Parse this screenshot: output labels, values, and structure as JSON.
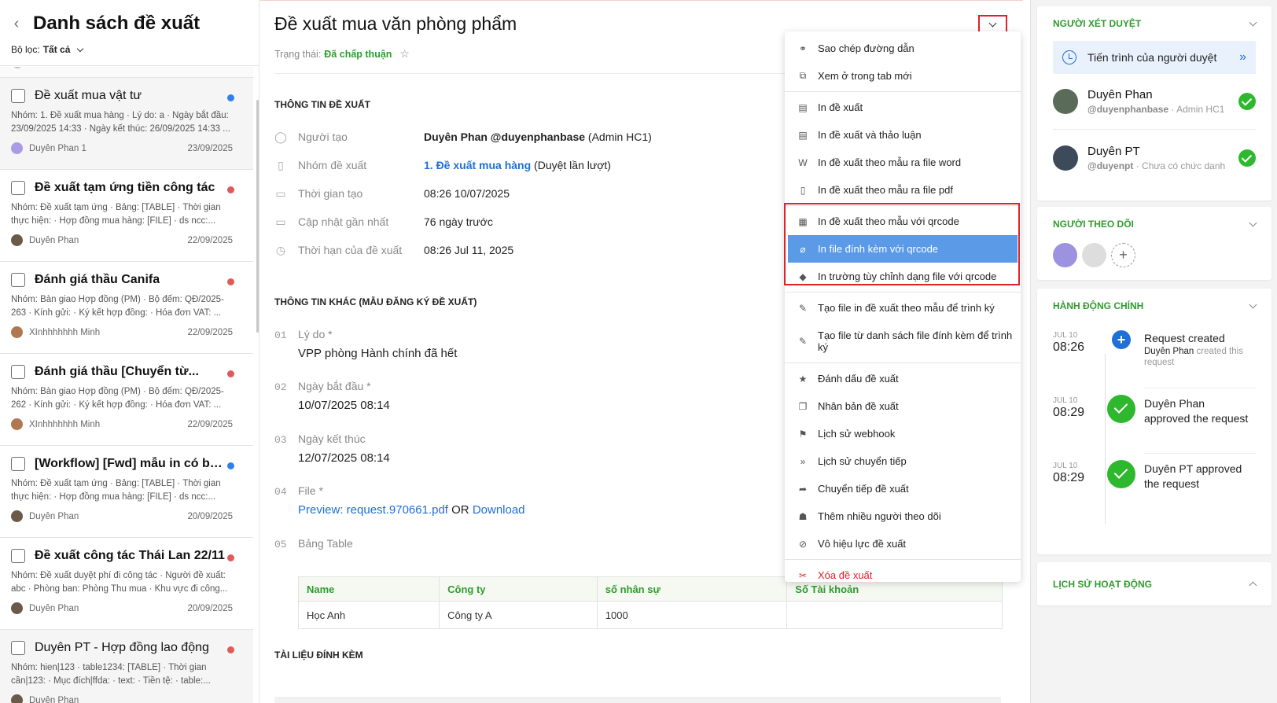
{
  "left": {
    "title": "Danh sách đề xuất",
    "filter_label": "Bộ lọc:",
    "filter_value": "Tất cả",
    "items": [
      {
        "title": "Đề xuất mua vật tư",
        "bold": false,
        "dot": "#2f80ed",
        "desc": "Nhóm: 1. Đề xuất mua hàng · Lý do: a · Ngày bắt đầu: 23/09/2025 14:33 · Ngày kết thúc: 26/09/2025 14:33 ...",
        "author": "Duyên Phan 1",
        "date": "23/09/2025",
        "gray": true
      },
      {
        "title": "Đề xuất tạm ứng tiền công tác",
        "bold": true,
        "dot": "#e05a5a",
        "desc": "Nhóm: Đề xuất tạm ứng · Bảng: [TABLE] · Thời gian thực hiện: · Hợp đồng mua hàng: [FILE] · ds ncc:...",
        "author": "Duyên Phan",
        "date": "22/09/2025",
        "gray": false
      },
      {
        "title": "Đánh giá thầu Canifa",
        "bold": true,
        "dot": "#e05a5a",
        "desc": "Nhóm: Bàn giao Hợp đồng (PM) · Bộ đếm: QĐ/2025-263 · Kính gửi: · Ký kết hợp đồng: · Hóa đơn VAT: ...",
        "author": "XInhhhhhhh Minh",
        "date": "22/09/2025",
        "gray": false
      },
      {
        "title": "Đánh giá thầu [Chuyển từ...",
        "bold": true,
        "dot": "#e05a5a",
        "desc": "Nhóm: Bàn giao Hợp đồng (PM) · Bộ đếm: QĐ/2025-262 · Kính gửi: · Ký kết hợp đồng: · Hóa đơn VAT: ...",
        "author": "XInhhhhhhh Minh",
        "date": "22/09/2025",
        "gray": false
      },
      {
        "title": "[Workflow] [Fwd] mẫu in có bản...",
        "bold": true,
        "dot": "#2f80ed",
        "desc": "Nhóm: Đề xuất tạm ứng · Bảng: [TABLE] · Thời gian thực hiện: · Hợp đồng mua hàng: [FILE] · ds ncc:...",
        "author": "Duyên Phan",
        "date": "20/09/2025",
        "gray": false
      },
      {
        "title": "Đề xuất công tác Thái Lan 22/11",
        "bold": true,
        "dot": "#e05a5a",
        "desc": "Nhóm: Đề xuất duyệt phí đi công tác · Người đề xuất: abc · Phòng ban: Phòng Thu mua · Khu vực đi công...",
        "author": "Duyên Phan",
        "date": "20/09/2025",
        "gray": false
      },
      {
        "title": "Duyên PT - Hợp đồng lao động",
        "bold": false,
        "dot": "#e05a5a",
        "desc": "Nhóm: hien|123 · table1234: [TABLE] · Thời gian cần|123: · Mục đích|ffda: · text: · Tiền tệ: · table:...",
        "author": "Duyên Phan",
        "date": "",
        "gray": true
      }
    ]
  },
  "main": {
    "title": "Đề xuất mua văn phòng phẩm",
    "status_label": "Trạng thái:",
    "status_value": "Đã chấp thuận",
    "section_info": "THÔNG TIN ĐỀ XUẤT",
    "fields": [
      {
        "icon": "user-icon",
        "label": "Người tạo",
        "value_bold": "Duyên Phan @duyenphanbase",
        "value": " (Admin HC1)"
      },
      {
        "icon": "clipboard-icon",
        "label": "Nhóm đề xuất",
        "value_link": "1. Đề xuất mua hàng",
        "value": " (Duyệt lần lượt)"
      },
      {
        "icon": "calendar-icon",
        "label": "Thời gian tạo",
        "value": "08:26 10/07/2025"
      },
      {
        "icon": "calendar-icon",
        "label": "Cập nhật gần nhất",
        "value": "76 ngày trước"
      },
      {
        "icon": "clock-icon",
        "label": "Thời hạn của đề xuất",
        "value": "08:26 Jul 11, 2025"
      }
    ],
    "section_other": "THÔNG TIN KHÁC (MẪU ĐĂNG KÝ ĐỀ XUẤT)",
    "other": [
      {
        "num": "01",
        "label": "Lý do *",
        "value": "VPP phòng Hành chính đã hết"
      },
      {
        "num": "02",
        "label": "Ngày bắt đầu *",
        "value": "10/07/2025 08:14"
      },
      {
        "num": "03",
        "label": "Ngày kết thúc",
        "value": "12/07/2025 08:14"
      },
      {
        "num": "04",
        "label": "File *",
        "preview": "Preview: request.970661.pdf",
        "or": " OR ",
        "download": "Download"
      },
      {
        "num": "05",
        "label": "Bảng Table"
      }
    ],
    "table": {
      "headers": [
        "Name",
        "Công ty",
        "số nhân sự",
        "Số Tài khoản"
      ],
      "rows": [
        [
          "Học Anh",
          "Công ty A",
          "1000",
          ""
        ]
      ]
    },
    "section_attach": "TÀI LIỆU ĐÍNH KÈM"
  },
  "menu": {
    "items": [
      {
        "icon": "link-icon",
        "glyph": "⚭",
        "label": "Sao chép đường dẫn"
      },
      {
        "icon": "external-link-icon",
        "glyph": "⧉",
        "label": "Xem ở trong tab mới"
      },
      {
        "sep": true
      },
      {
        "icon": "printer-icon",
        "glyph": "▤",
        "label": "In đề xuất"
      },
      {
        "icon": "printer-icon",
        "glyph": "▤",
        "label": "In đề xuất và thảo luận"
      },
      {
        "icon": "word-file-icon",
        "glyph": "W",
        "label": "In đề xuất theo mẫu ra file word"
      },
      {
        "icon": "pdf-file-icon",
        "glyph": "▯",
        "label": "In đề xuất theo mẫu ra file pdf"
      },
      {
        "sep": true
      },
      {
        "icon": "qrcode-icon",
        "glyph": "▦",
        "label": "In đề xuất theo mẫu với qrcode"
      },
      {
        "icon": "paperclip-icon",
        "glyph": "⌀",
        "label": "In file đính kèm với qrcode",
        "active": true
      },
      {
        "icon": "layers-icon",
        "glyph": "◆",
        "label": "In trường tùy chỉnh dạng file với qrcode"
      },
      {
        "sep": true
      },
      {
        "icon": "pencil-icon",
        "glyph": "✎",
        "label": "Tạo file in đề xuất theo mẫu để trình ký"
      },
      {
        "icon": "pencil-icon",
        "glyph": "✎",
        "label": "Tạo file từ danh sách file đính kèm để trình ký",
        "tall": true
      },
      {
        "sep": true
      },
      {
        "icon": "star-icon",
        "glyph": "★",
        "label": "Đánh dấu đề xuất"
      },
      {
        "icon": "copy-icon",
        "glyph": "❐",
        "label": "Nhân bản đề xuất"
      },
      {
        "icon": "flag-icon",
        "glyph": "⚑",
        "label": "Lịch sử webhook"
      },
      {
        "icon": "forward-icon",
        "glyph": "»",
        "label": "Lịch sử chuyển tiếp"
      },
      {
        "icon": "share-icon",
        "glyph": "➦",
        "label": "Chuyển tiếp đề xuất"
      },
      {
        "icon": "users-icon",
        "glyph": "☗",
        "label": "Thêm nhiều người theo dõi"
      },
      {
        "icon": "ban-icon",
        "glyph": "⊘",
        "label": "Vô hiệu lực đề xuất"
      },
      {
        "sep": true
      },
      {
        "icon": "scissors-icon",
        "glyph": "✂",
        "label": "Xóa đề xuất",
        "danger": true
      }
    ]
  },
  "right": {
    "approvers_title": "NGƯỜI XÉT DUYỆT",
    "progress_label": "Tiến trình của người duyệt",
    "approvers": [
      {
        "name": "Duyên Phan",
        "handle": "@duyenphanbase",
        "role": " · Admin HC1"
      },
      {
        "name": "Duyên PT",
        "handle": "@duyenpt",
        "role": " · Chưa có chức danh"
      }
    ],
    "followers_title": "NGƯỜI THEO DÕI",
    "actions_title": "HÀNH ĐỘNG CHÍNH",
    "timeline": [
      {
        "month": "JUL 10",
        "time": "08:26",
        "text": "Request created",
        "by": "Duyên Phan",
        "by_suffix": " created this request",
        "kind": "created"
      },
      {
        "month": "JUL 10",
        "time": "08:29",
        "text": "Duyên Phan",
        "text2": "approved the request",
        "kind": "approved"
      },
      {
        "month": "JUL 10",
        "time": "08:29",
        "text": "Duyên PT approved",
        "text2": "the request",
        "kind": "approved"
      }
    ],
    "history_title": "LỊCH SỬ HOẠT ĐỘNG"
  },
  "colors": {
    "accent_green": "#2e9c2e",
    "link_blue": "#1e6fd6",
    "highlight_red": "#e0202a",
    "menu_active": "#5a9ae6"
  }
}
